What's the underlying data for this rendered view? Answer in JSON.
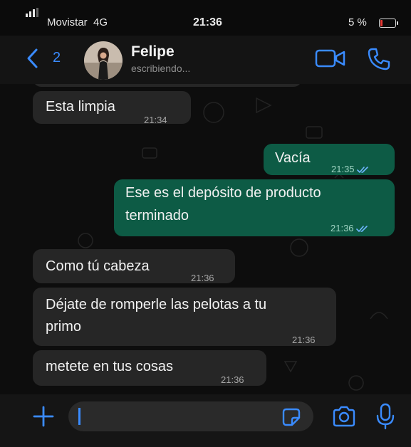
{
  "status_bar": {
    "carrier": "Movistar",
    "network": "4G",
    "time": "21:36",
    "battery": "5 %"
  },
  "header": {
    "back_count": "2",
    "contact_name": "Felipe",
    "contact_status": "escribiendo..."
  },
  "messages": [
    {
      "direction": "incoming",
      "lines": [
        "Esta limpia"
      ],
      "time": "21:34"
    },
    {
      "direction": "outgoing",
      "lines": [
        "Vacía"
      ],
      "time": "21:35",
      "read": true
    },
    {
      "direction": "outgoing",
      "lines": [
        "Ese es el depósito de producto",
        "terminado"
      ],
      "time": "21:36",
      "read": true
    },
    {
      "direction": "incoming",
      "lines": [
        "Como tú cabeza"
      ],
      "time": "21:36"
    },
    {
      "direction": "incoming",
      "lines": [
        "Déjate de romperle las pelotas a tu",
        "primo"
      ],
      "time": "21:36"
    },
    {
      "direction": "incoming",
      "lines": [
        "metete en tus cosas"
      ],
      "time": "21:36"
    }
  ],
  "colors": {
    "accent": "#3a8bff",
    "outgoing_bubble": "#0d5b45",
    "incoming_bubble": "#262626",
    "read_ticks": "#6fb6ff",
    "battery_low": "#e53935"
  },
  "icons": [
    "back-chevron-icon",
    "video-call-icon",
    "phone-call-icon",
    "plus-icon",
    "sticker-icon",
    "camera-icon",
    "microphone-icon",
    "read-receipt-icon"
  ]
}
